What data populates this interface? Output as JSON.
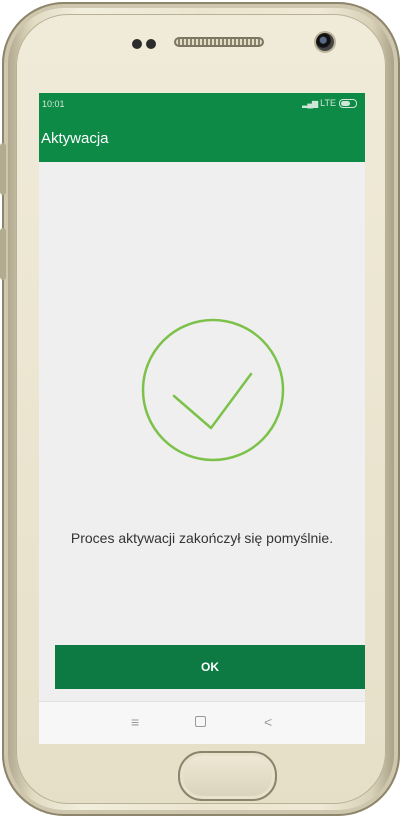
{
  "status_bar": {
    "time": "10:01",
    "network": "LTE",
    "signal_icon": "signal-icon",
    "battery_icon": "battery-icon"
  },
  "app_bar": {
    "title": "Aktywacja",
    "color": "#0e8a47"
  },
  "content": {
    "success_icon": "checkmark-circle-icon",
    "success_color": "#7cc24a",
    "message": "Proces aktywacji zakończył się pomyślnie."
  },
  "ok_button": {
    "label": "OK",
    "color": "#0e7a43"
  },
  "nav_bar": {
    "menu_icon": "menu-icon",
    "home_icon": "home-icon",
    "back_icon": "back-icon",
    "menu_glyph": "≡",
    "back_glyph": "<"
  },
  "device": {
    "recent_key": "recent-apps-key",
    "home_key": "home-key",
    "back_key": "back-key",
    "back_glyph": "⮌"
  }
}
